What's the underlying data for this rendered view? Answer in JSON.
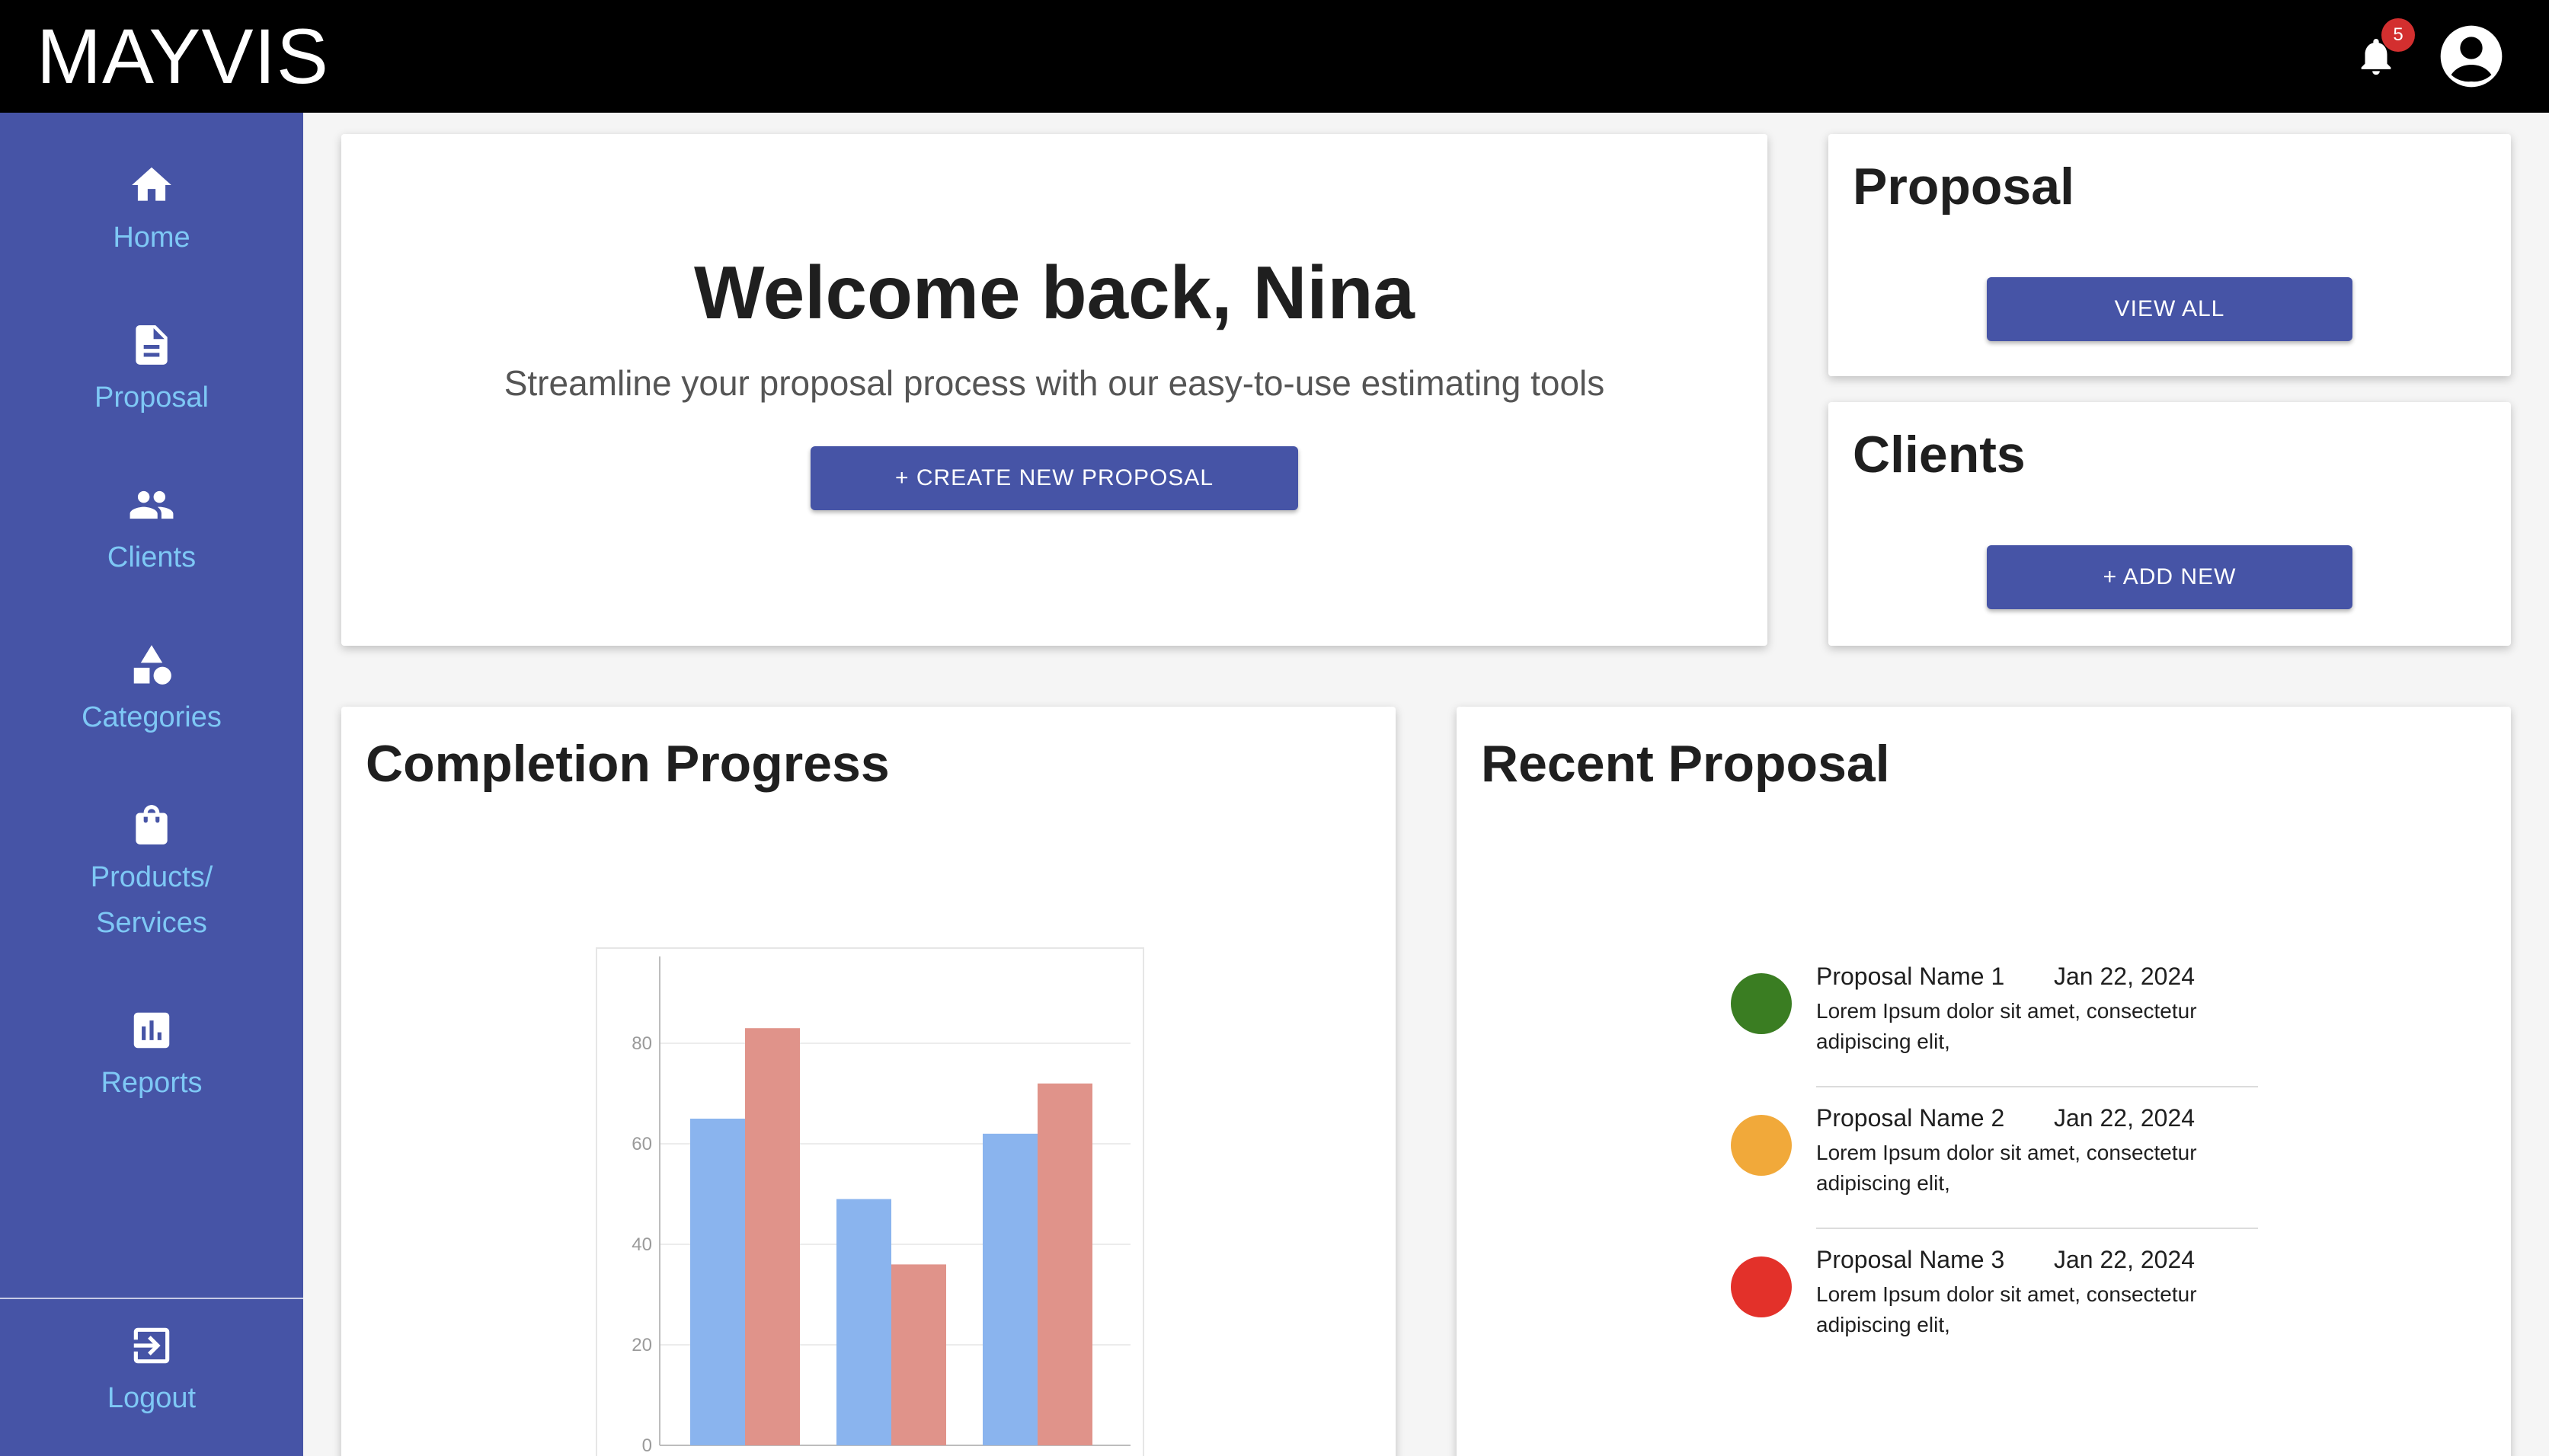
{
  "app": {
    "brand": "MAYVIS",
    "notification_count": "5"
  },
  "sidebar": {
    "items": [
      {
        "label": "Home",
        "icon": "home-icon"
      },
      {
        "label": "Proposal",
        "icon": "document-icon"
      },
      {
        "label": "Clients",
        "icon": "people-icon"
      },
      {
        "label": "Categories",
        "icon": "shapes-icon"
      },
      {
        "label": "Products/\nServices",
        "icon": "shopping-bag-icon"
      },
      {
        "label": "Reports",
        "icon": "bar-chart-icon"
      }
    ],
    "logout": {
      "label": "Logout",
      "icon": "logout-icon"
    },
    "label_color": "#7ec8f5",
    "bg_color": "#4654a6"
  },
  "welcome": {
    "title": "Welcome back, Nina",
    "subtitle": "Streamline your proposal process with our easy-to-use estimating tools",
    "button": "+ CREATE NEW PROPOSAL"
  },
  "proposal_card": {
    "title": "Proposal",
    "button": "VIEW ALL"
  },
  "clients_card": {
    "title": "Clients",
    "button": "+ ADD NEW"
  },
  "progress": {
    "title": "Completion Progress"
  },
  "recent": {
    "title": "Recent Proposal",
    "items": [
      {
        "name": "Proposal Name 1",
        "date": "Jan 22, 2024",
        "desc": "Lorem Ipsum dolor sit amet, consectetur adipiscing elit,",
        "status_color": "#3a7d22"
      },
      {
        "name": "Proposal Name 2",
        "date": "Jan 22, 2024",
        "desc": "Lorem Ipsum dolor sit amet, consectetur adipiscing elit,",
        "status_color": "#f1a93a"
      },
      {
        "name": "Proposal Name 3",
        "date": "Jan 22, 2024",
        "desc": "Lorem Ipsum dolor sit amet, consectetur adipiscing elit,",
        "status_color": "#e3312a"
      }
    ]
  },
  "chart_data": {
    "type": "bar",
    "categories": [
      "",
      "",
      ""
    ],
    "series": [
      {
        "values": [
          65,
          49,
          62
        ],
        "color": "#8ab4ee"
      },
      {
        "values": [
          83,
          36,
          72
        ],
        "color": "#e0938a"
      }
    ],
    "ylim": [
      0,
      86
    ],
    "yticks": [
      "0",
      "20",
      "40",
      "60",
      "80"
    ],
    "grid": true
  },
  "colors": {
    "accent": "#4654a6",
    "topbar": "#000000",
    "badge": "#d32f2f"
  }
}
